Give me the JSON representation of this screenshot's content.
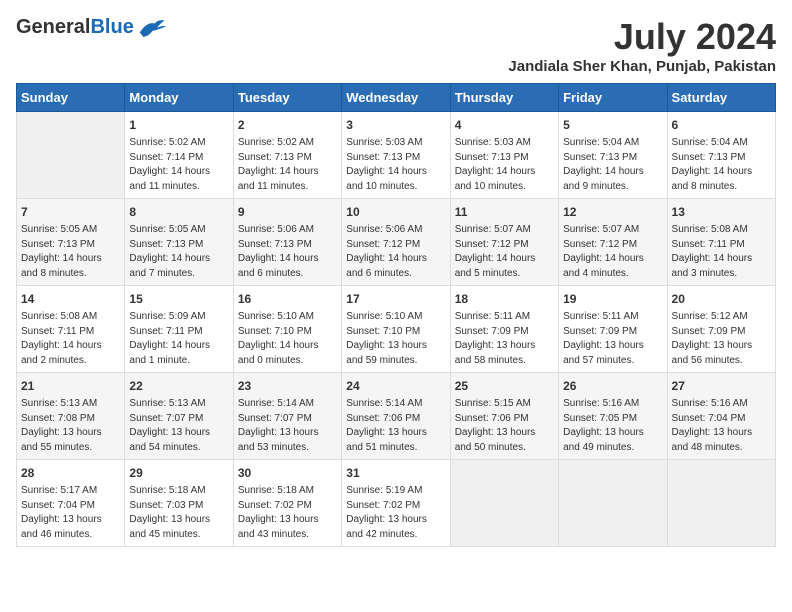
{
  "header": {
    "logo_general": "General",
    "logo_blue": "Blue",
    "month_title": "July 2024",
    "location": "Jandiala Sher Khan, Punjab, Pakistan"
  },
  "days_of_week": [
    "Sunday",
    "Monday",
    "Tuesday",
    "Wednesday",
    "Thursday",
    "Friday",
    "Saturday"
  ],
  "weeks": [
    [
      {
        "day": "",
        "sunrise": "",
        "sunset": "",
        "daylight": "",
        "empty": true
      },
      {
        "day": "1",
        "sunrise": "Sunrise: 5:02 AM",
        "sunset": "Sunset: 7:14 PM",
        "daylight": "Daylight: 14 hours and 11 minutes."
      },
      {
        "day": "2",
        "sunrise": "Sunrise: 5:02 AM",
        "sunset": "Sunset: 7:13 PM",
        "daylight": "Daylight: 14 hours and 11 minutes."
      },
      {
        "day": "3",
        "sunrise": "Sunrise: 5:03 AM",
        "sunset": "Sunset: 7:13 PM",
        "daylight": "Daylight: 14 hours and 10 minutes."
      },
      {
        "day": "4",
        "sunrise": "Sunrise: 5:03 AM",
        "sunset": "Sunset: 7:13 PM",
        "daylight": "Daylight: 14 hours and 10 minutes."
      },
      {
        "day": "5",
        "sunrise": "Sunrise: 5:04 AM",
        "sunset": "Sunset: 7:13 PM",
        "daylight": "Daylight: 14 hours and 9 minutes."
      },
      {
        "day": "6",
        "sunrise": "Sunrise: 5:04 AM",
        "sunset": "Sunset: 7:13 PM",
        "daylight": "Daylight: 14 hours and 8 minutes."
      }
    ],
    [
      {
        "day": "7",
        "sunrise": "Sunrise: 5:05 AM",
        "sunset": "Sunset: 7:13 PM",
        "daylight": "Daylight: 14 hours and 8 minutes."
      },
      {
        "day": "8",
        "sunrise": "Sunrise: 5:05 AM",
        "sunset": "Sunset: 7:13 PM",
        "daylight": "Daylight: 14 hours and 7 minutes."
      },
      {
        "day": "9",
        "sunrise": "Sunrise: 5:06 AM",
        "sunset": "Sunset: 7:13 PM",
        "daylight": "Daylight: 14 hours and 6 minutes."
      },
      {
        "day": "10",
        "sunrise": "Sunrise: 5:06 AM",
        "sunset": "Sunset: 7:12 PM",
        "daylight": "Daylight: 14 hours and 6 minutes."
      },
      {
        "day": "11",
        "sunrise": "Sunrise: 5:07 AM",
        "sunset": "Sunset: 7:12 PM",
        "daylight": "Daylight: 14 hours and 5 minutes."
      },
      {
        "day": "12",
        "sunrise": "Sunrise: 5:07 AM",
        "sunset": "Sunset: 7:12 PM",
        "daylight": "Daylight: 14 hours and 4 minutes."
      },
      {
        "day": "13",
        "sunrise": "Sunrise: 5:08 AM",
        "sunset": "Sunset: 7:11 PM",
        "daylight": "Daylight: 14 hours and 3 minutes."
      }
    ],
    [
      {
        "day": "14",
        "sunrise": "Sunrise: 5:08 AM",
        "sunset": "Sunset: 7:11 PM",
        "daylight": "Daylight: 14 hours and 2 minutes."
      },
      {
        "day": "15",
        "sunrise": "Sunrise: 5:09 AM",
        "sunset": "Sunset: 7:11 PM",
        "daylight": "Daylight: 14 hours and 1 minute."
      },
      {
        "day": "16",
        "sunrise": "Sunrise: 5:10 AM",
        "sunset": "Sunset: 7:10 PM",
        "daylight": "Daylight: 14 hours and 0 minutes."
      },
      {
        "day": "17",
        "sunrise": "Sunrise: 5:10 AM",
        "sunset": "Sunset: 7:10 PM",
        "daylight": "Daylight: 13 hours and 59 minutes."
      },
      {
        "day": "18",
        "sunrise": "Sunrise: 5:11 AM",
        "sunset": "Sunset: 7:09 PM",
        "daylight": "Daylight: 13 hours and 58 minutes."
      },
      {
        "day": "19",
        "sunrise": "Sunrise: 5:11 AM",
        "sunset": "Sunset: 7:09 PM",
        "daylight": "Daylight: 13 hours and 57 minutes."
      },
      {
        "day": "20",
        "sunrise": "Sunrise: 5:12 AM",
        "sunset": "Sunset: 7:09 PM",
        "daylight": "Daylight: 13 hours and 56 minutes."
      }
    ],
    [
      {
        "day": "21",
        "sunrise": "Sunrise: 5:13 AM",
        "sunset": "Sunset: 7:08 PM",
        "daylight": "Daylight: 13 hours and 55 minutes."
      },
      {
        "day": "22",
        "sunrise": "Sunrise: 5:13 AM",
        "sunset": "Sunset: 7:07 PM",
        "daylight": "Daylight: 13 hours and 54 minutes."
      },
      {
        "day": "23",
        "sunrise": "Sunrise: 5:14 AM",
        "sunset": "Sunset: 7:07 PM",
        "daylight": "Daylight: 13 hours and 53 minutes."
      },
      {
        "day": "24",
        "sunrise": "Sunrise: 5:14 AM",
        "sunset": "Sunset: 7:06 PM",
        "daylight": "Daylight: 13 hours and 51 minutes."
      },
      {
        "day": "25",
        "sunrise": "Sunrise: 5:15 AM",
        "sunset": "Sunset: 7:06 PM",
        "daylight": "Daylight: 13 hours and 50 minutes."
      },
      {
        "day": "26",
        "sunrise": "Sunrise: 5:16 AM",
        "sunset": "Sunset: 7:05 PM",
        "daylight": "Daylight: 13 hours and 49 minutes."
      },
      {
        "day": "27",
        "sunrise": "Sunrise: 5:16 AM",
        "sunset": "Sunset: 7:04 PM",
        "daylight": "Daylight: 13 hours and 48 minutes."
      }
    ],
    [
      {
        "day": "28",
        "sunrise": "Sunrise: 5:17 AM",
        "sunset": "Sunset: 7:04 PM",
        "daylight": "Daylight: 13 hours and 46 minutes."
      },
      {
        "day": "29",
        "sunrise": "Sunrise: 5:18 AM",
        "sunset": "Sunset: 7:03 PM",
        "daylight": "Daylight: 13 hours and 45 minutes."
      },
      {
        "day": "30",
        "sunrise": "Sunrise: 5:18 AM",
        "sunset": "Sunset: 7:02 PM",
        "daylight": "Daylight: 13 hours and 43 minutes."
      },
      {
        "day": "31",
        "sunrise": "Sunrise: 5:19 AM",
        "sunset": "Sunset: 7:02 PM",
        "daylight": "Daylight: 13 hours and 42 minutes."
      },
      {
        "day": "",
        "sunrise": "",
        "sunset": "",
        "daylight": "",
        "empty": true
      },
      {
        "day": "",
        "sunrise": "",
        "sunset": "",
        "daylight": "",
        "empty": true
      },
      {
        "day": "",
        "sunrise": "",
        "sunset": "",
        "daylight": "",
        "empty": true
      }
    ]
  ]
}
